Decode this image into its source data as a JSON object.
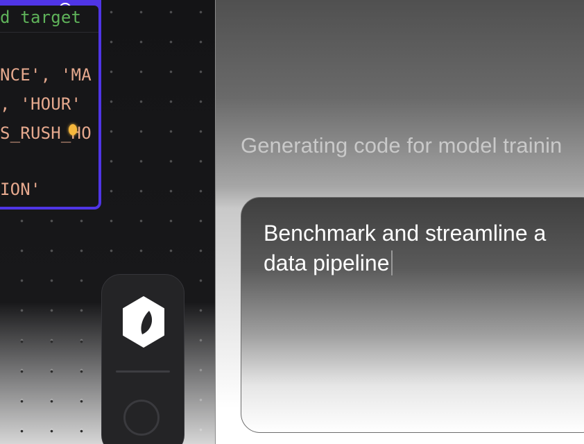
{
  "code_editor": {
    "lines": [
      {
        "kind": "comment",
        "text": "d target"
      },
      {
        "kind": "string",
        "text": "NCE', 'MA"
      },
      {
        "kind": "string",
        "text": ", 'HOUR'"
      },
      {
        "kind": "string",
        "text": "S_RUSH_HO"
      },
      {
        "kind": "string",
        "text": "ION'"
      }
    ],
    "more_icon": "more-horizontal-icon",
    "accent_color": "#4f35e6"
  },
  "dock": {
    "logo_icon": "hexagon-leaf-logo",
    "status_icon": "loading-spinner-icon"
  },
  "status": {
    "text": "Generating code for model trainin"
  },
  "prompt": {
    "value": "Benchmark and streamline a data pipeline"
  }
}
